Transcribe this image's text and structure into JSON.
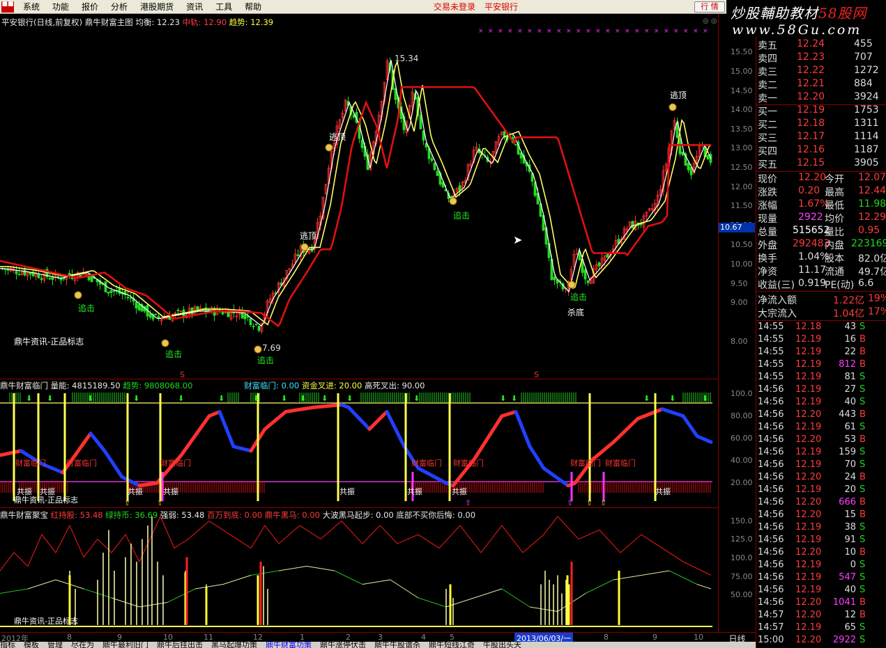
{
  "menu": {
    "items": [
      "系统",
      "功能",
      "报价",
      "分析",
      "港股期货",
      "资讯",
      "工具",
      "帮助"
    ],
    "status": "交易未登录",
    "bank": "平安银行",
    "quote_btn": "行 情"
  },
  "watermark": {
    "line1": "炒股輔助教材",
    "line1b": "58股网",
    "line2": "www.58Gu.com"
  },
  "main_title": {
    "name": "平安银行(日线,前复权) 鼎牛财富主图",
    "jun": "均衡: 12.23",
    "zx": "中轨: 12.90",
    "qs": "趋势: 12.39"
  },
  "annotations": {
    "peak": "15.34",
    "low": "7.69",
    "escape": "逃顶",
    "chase": "追击",
    "bottom": "杀底",
    "brand": "鼎牛资讯-正品标志",
    "price_tag": "10.67"
  },
  "price_axis": [
    "15.50",
    "15.00",
    "14.50",
    "14.00",
    "13.50",
    "13.00",
    "12.50",
    "12.00",
    "11.50",
    "11.00",
    "10.50",
    "10.00",
    "9.50",
    "9.00",
    "8.00"
  ],
  "ind1": {
    "name": "鼎牛财富临门",
    "l1": "量能: 4815189.50",
    "l2": "趋势: 9808068.00",
    "l3": "财富临门: 0.00",
    "l4": "资金叉进: 20.00",
    "l5": "高死叉出: 90.00",
    "label": "财富临门",
    "gz": "共振",
    "axis": [
      "100.0",
      "80.00",
      "60.00",
      "40.00",
      "20.00"
    ]
  },
  "ind2": {
    "name": "鼎牛财富聚宝",
    "l1": "红持股: 53.48",
    "l2": "绿持币: 36.69",
    "l3": "强弱: 53.48",
    "l4": "百万到底: 0.00",
    "l5": "鼎牛黑马: 0.00",
    "l6": "大波黑马起步: 0.00",
    "l7": "底部不买你后悔: 0.00",
    "axis": [
      "150.0",
      "125.0",
      "100.0",
      "75.00",
      "50.00"
    ]
  },
  "dates": [
    "2012年",
    "8",
    "9",
    "10",
    "11",
    "12",
    "1",
    "2",
    "3",
    "4",
    "5",
    "2013/06/03/一",
    "8",
    "9",
    "10"
  ],
  "period": "日线",
  "bottom_tabs": [
    "指标",
    "模板",
    "管理",
    "尽在为",
    "鼎牛最利旧门",
    "鼎牛后挂出击",
    "黑马起爆功策",
    "鼎牛财富功策",
    "鼎牛涨停伏击",
    "鼎牛牛股谱杀",
    "鼎牛短线江奇",
    "牛股出头天"
  ],
  "quotes": {
    "sell": [
      [
        "卖五",
        "12.24",
        "455"
      ],
      [
        "卖四",
        "12.23",
        "707"
      ],
      [
        "卖三",
        "12.22",
        "1272"
      ],
      [
        "卖二",
        "12.21",
        "884"
      ],
      [
        "卖一",
        "12.20",
        "3924"
      ]
    ],
    "buy": [
      [
        "买一",
        "12.19",
        "1753"
      ],
      [
        "买二",
        "12.18",
        "1311"
      ],
      [
        "买三",
        "12.17",
        "1114"
      ],
      [
        "买四",
        "12.16",
        "1187"
      ],
      [
        "买五",
        "12.15",
        "3905"
      ]
    ],
    "stats": [
      [
        "现价",
        "12.20",
        "今开",
        "12.07"
      ],
      [
        "涨跌",
        "0.20",
        "最高",
        "12.44"
      ],
      [
        "涨幅",
        "1.67%",
        "最低",
        "11.98"
      ],
      [
        "现量",
        "2922",
        "均价",
        "12.29"
      ],
      [
        "总量",
        "515652",
        "量比",
        "0.95"
      ],
      [
        "外盘",
        "292483",
        "内盘",
        "223169"
      ],
      [
        "换手",
        "1.04%",
        "股本",
        "82.0亿"
      ],
      [
        "净资",
        "11.17",
        "流通",
        "49.7亿"
      ],
      [
        "收益(三)",
        "0.919",
        "PE(动)",
        "6.6"
      ]
    ],
    "flow": [
      [
        "净流入额",
        "1.22亿",
        "19%"
      ],
      [
        "大宗流入",
        "1.04亿",
        "17%"
      ]
    ],
    "ticks": [
      [
        "14:55",
        "12.18",
        "43",
        "S"
      ],
      [
        "14:55",
        "12.19",
        "16",
        "B"
      ],
      [
        "14:55",
        "12.19",
        "22",
        "B"
      ],
      [
        "14:55",
        "12.19",
        "812",
        "B"
      ],
      [
        "14:55",
        "12.19",
        "81",
        "S"
      ],
      [
        "14:56",
        "12.19",
        "27",
        "S"
      ],
      [
        "14:56",
        "12.19",
        "40",
        "S"
      ],
      [
        "14:56",
        "12.20",
        "443",
        "B"
      ],
      [
        "14:56",
        "12.19",
        "61",
        "S"
      ],
      [
        "14:56",
        "12.20",
        "53",
        "B"
      ],
      [
        "14:56",
        "12.19",
        "159",
        "S"
      ],
      [
        "14:56",
        "12.19",
        "70",
        "S"
      ],
      [
        "14:56",
        "12.20",
        "24",
        "B"
      ],
      [
        "14:56",
        "12.19",
        "20",
        "S"
      ],
      [
        "14:56",
        "12.20",
        "666",
        "B"
      ],
      [
        "14:56",
        "12.20",
        "15",
        "B"
      ],
      [
        "14:56",
        "12.19",
        "38",
        "S"
      ],
      [
        "14:56",
        "12.19",
        "91",
        "S"
      ],
      [
        "14:56",
        "12.20",
        "10",
        "B"
      ],
      [
        "14:56",
        "12.19",
        "0",
        "S"
      ],
      [
        "14:56",
        "12.19",
        "547",
        "S"
      ],
      [
        "14:56",
        "12.19",
        "40",
        "S"
      ],
      [
        "14:56",
        "12.20",
        "1041",
        "B"
      ],
      [
        "14:57",
        "12.20",
        "12",
        "B"
      ],
      [
        "14:57",
        "12.19",
        "65",
        "S"
      ],
      [
        "15:00",
        "12.20",
        "2922",
        "S"
      ]
    ]
  }
}
